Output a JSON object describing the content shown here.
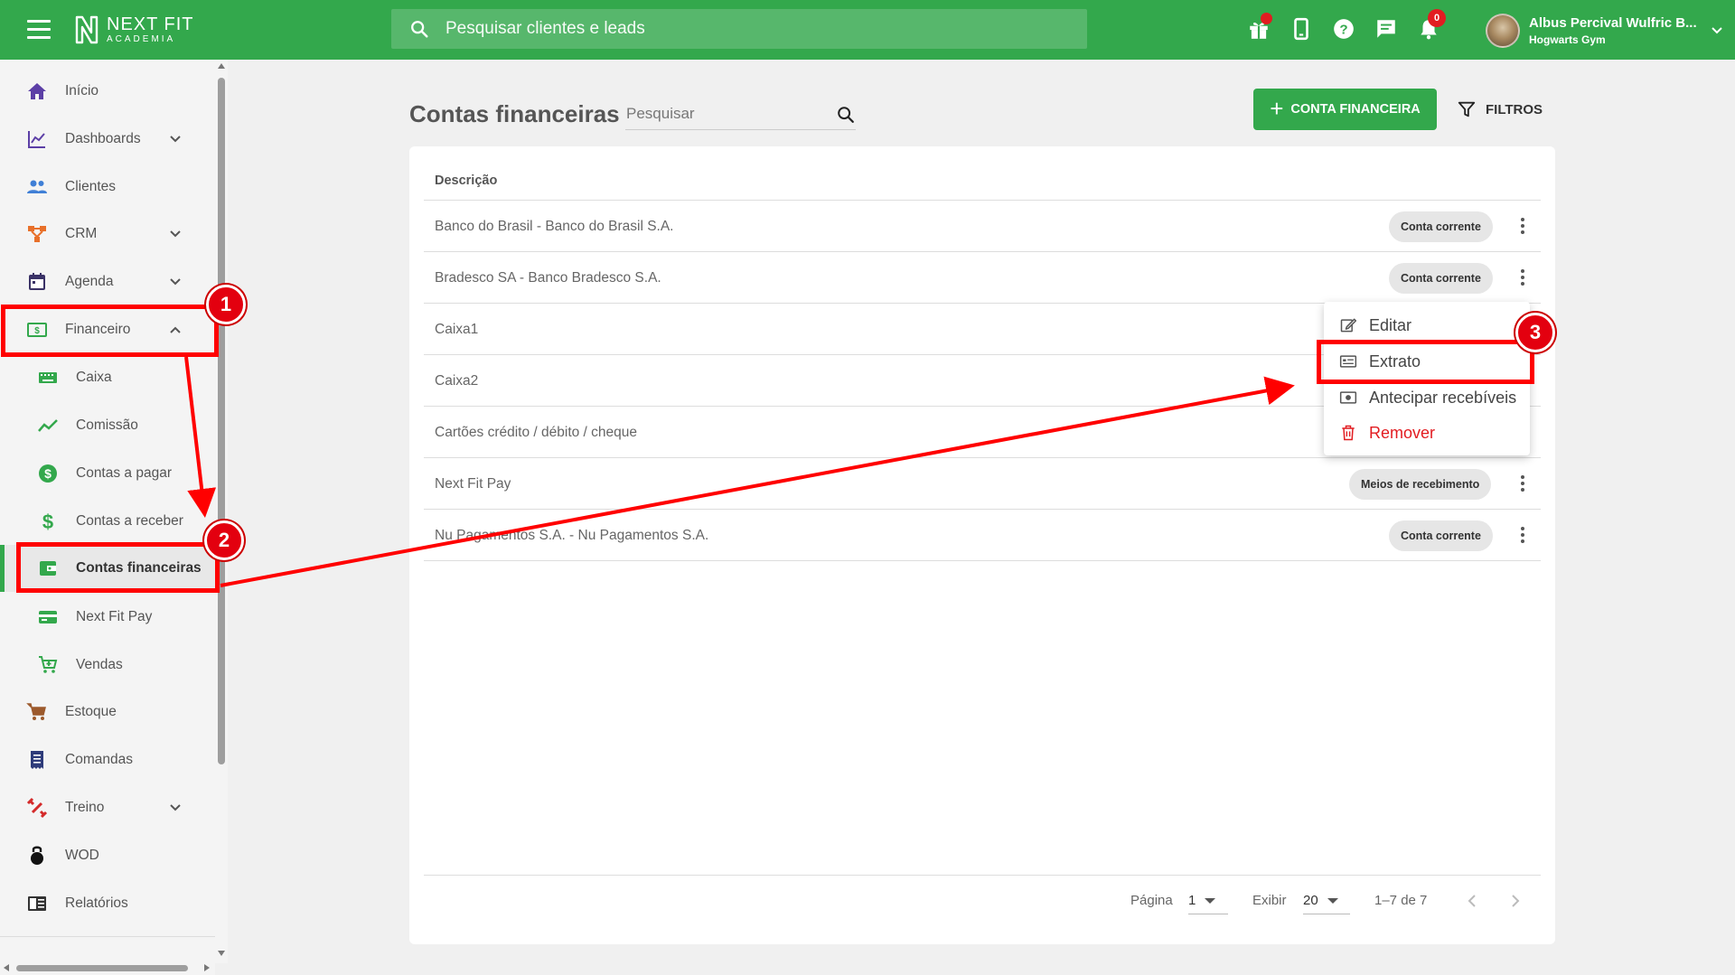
{
  "header": {
    "logo_line1": "NEXT FIT",
    "logo_line2": "ACADEMIA",
    "search_placeholder": "Pesquisar clientes e leads",
    "notification_count": "0",
    "user_name": "Albus Percival Wulfric B...",
    "user_gym": "Hogwarts Gym",
    "brand_color": "#33a84c",
    "alert_color": "#e21c21"
  },
  "sidebar": {
    "items": [
      {
        "label": "Início",
        "icon": "home-icon"
      },
      {
        "label": "Dashboards",
        "icon": "chart-line-icon"
      },
      {
        "label": "Clientes",
        "icon": "people-icon"
      },
      {
        "label": "CRM",
        "icon": "crm-icon"
      },
      {
        "label": "Agenda",
        "icon": "calendar-icon"
      },
      {
        "label": "Financeiro",
        "icon": "money-icon"
      },
      {
        "label": "Caixa",
        "icon": "keyboard-icon"
      },
      {
        "label": "Comissão",
        "icon": "trend-icon"
      },
      {
        "label": "Contas a pagar",
        "icon": "dollar-circle-icon"
      },
      {
        "label": "Contas a receber",
        "icon": "dollar-icon"
      },
      {
        "label": "Contas financeiras",
        "icon": "wallet-icon"
      },
      {
        "label": "Next Fit Pay",
        "icon": "card-icon"
      },
      {
        "label": "Vendas",
        "icon": "cart-plus-icon"
      },
      {
        "label": "Estoque",
        "icon": "cart-icon"
      },
      {
        "label": "Comandas",
        "icon": "receipt-icon"
      },
      {
        "label": "Treino",
        "icon": "dumbbell-icon"
      },
      {
        "label": "WOD",
        "icon": "kettlebell-icon"
      },
      {
        "label": "Relatórios",
        "icon": "report-icon"
      }
    ]
  },
  "main": {
    "title": "Contas financeiras",
    "search_placeholder": "Pesquisar",
    "add_button": "CONTA FINANCEIRA",
    "filter_button": "FILTROS",
    "column_header": "Descrição",
    "rows": [
      {
        "desc": "Banco do Brasil - Banco do Brasil S.A.",
        "chip": "Conta corrente"
      },
      {
        "desc": "Bradesco SA - Banco Bradesco S.A.",
        "chip": "Conta corrente"
      },
      {
        "desc": "Caixa1",
        "chip": ""
      },
      {
        "desc": "Caixa2",
        "chip": ""
      },
      {
        "desc": "Cartões crédito / débito / cheque",
        "chip": ""
      },
      {
        "desc": "Next Fit Pay",
        "chip": "Meios de recebimento"
      },
      {
        "desc": "Nu Pagamentos S.A. - Nu Pagamentos S.A.",
        "chip": "Conta corrente"
      }
    ],
    "pager": {
      "page_label": "Página",
      "page_value": "1",
      "show_label": "Exibir",
      "show_value": "20",
      "range": "1–7 de 7"
    }
  },
  "context_menu": {
    "items": [
      {
        "label": "Editar",
        "icon": "edit-icon"
      },
      {
        "label": "Extrato",
        "icon": "statement-icon"
      },
      {
        "label": "Antecipar recebíveis",
        "icon": "cash-icon"
      },
      {
        "label": "Remover",
        "icon": "trash-icon"
      }
    ]
  },
  "annotations": [
    "1",
    "2",
    "3"
  ]
}
